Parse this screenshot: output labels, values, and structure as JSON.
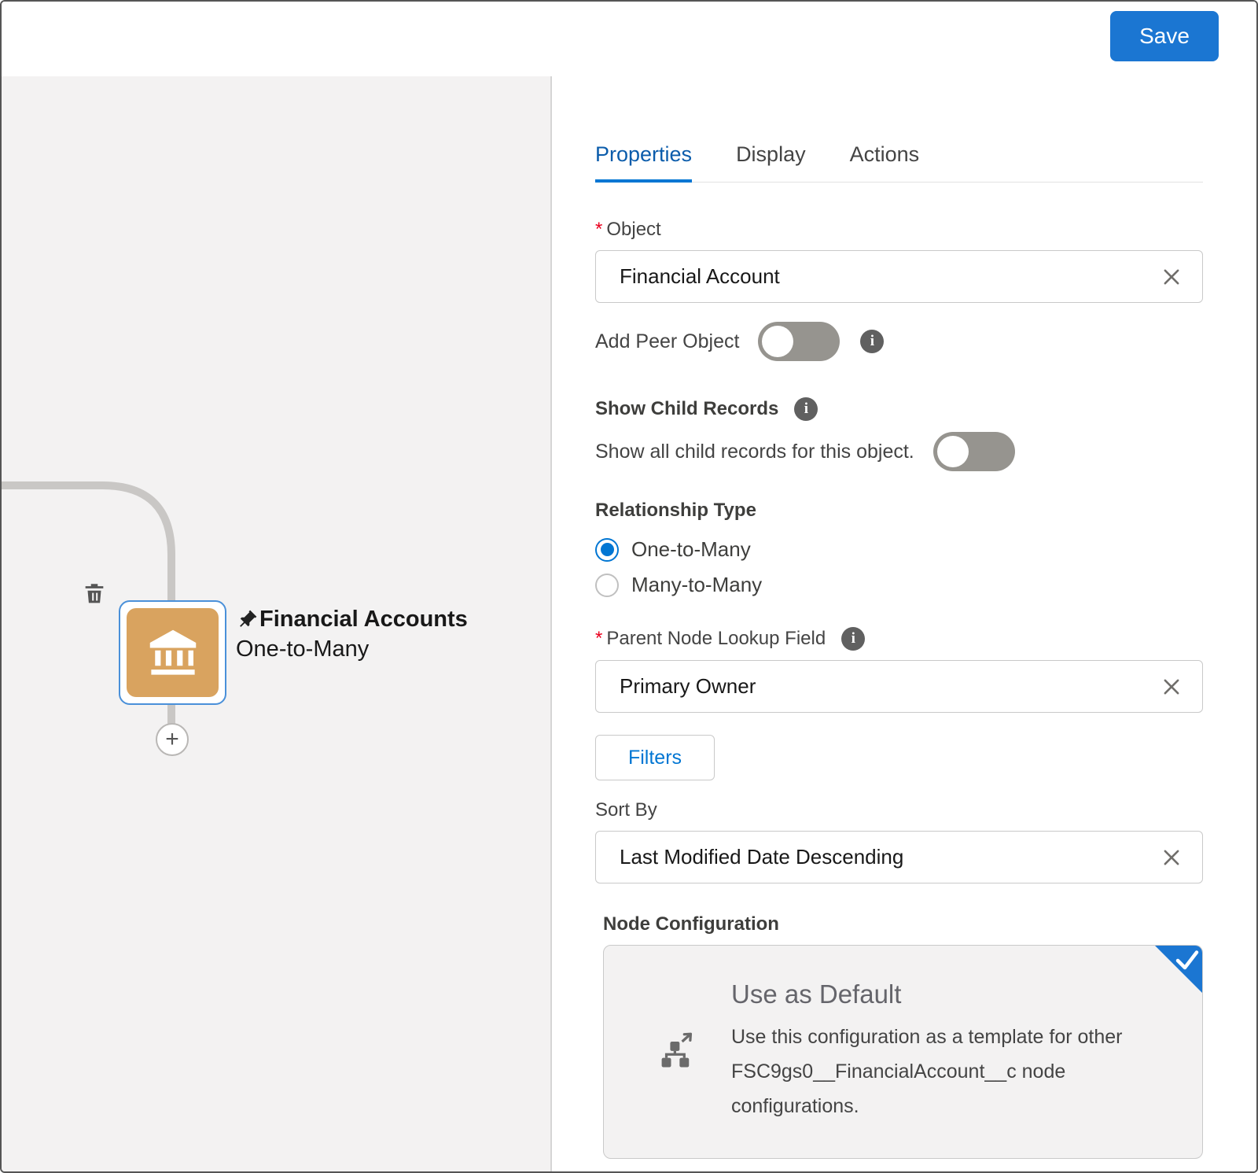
{
  "ui": {
    "required_marker": "*",
    "plus": "+",
    "info": "i"
  },
  "header": {
    "save_label": "Save"
  },
  "canvas": {
    "node": {
      "title": "Financial Accounts",
      "subtitle": "One-to-Many"
    }
  },
  "panel": {
    "tabs": [
      {
        "label": "Properties"
      },
      {
        "label": "Display"
      },
      {
        "label": "Actions"
      }
    ],
    "object_field": {
      "label": "Object",
      "value": "Financial Account"
    },
    "add_peer": {
      "label": "Add Peer Object",
      "state": "off"
    },
    "show_child": {
      "label": "Show Child Records",
      "desc": "Show all child records for this object.",
      "state": "off"
    },
    "relationship": {
      "label": "Relationship Type",
      "options": [
        {
          "label": "One-to-Many"
        },
        {
          "label": "Many-to-Many"
        }
      ],
      "selected": "One-to-Many"
    },
    "parent_lookup": {
      "label": "Parent Node Lookup Field",
      "value": "Primary Owner"
    },
    "filters_label": "Filters",
    "sort_by": {
      "label": "Sort By",
      "value": "Last Modified Date Descending"
    },
    "node_config": {
      "label": "Node Configuration",
      "card_title": "Use as Default",
      "card_body": "Use this configuration as a template for other FSC9gs0__FinancialAccount__c node configurations."
    }
  },
  "colors": {
    "accent": "#0176D3",
    "node_fill": "#D9A35F",
    "save_button": "#1B76D2"
  }
}
